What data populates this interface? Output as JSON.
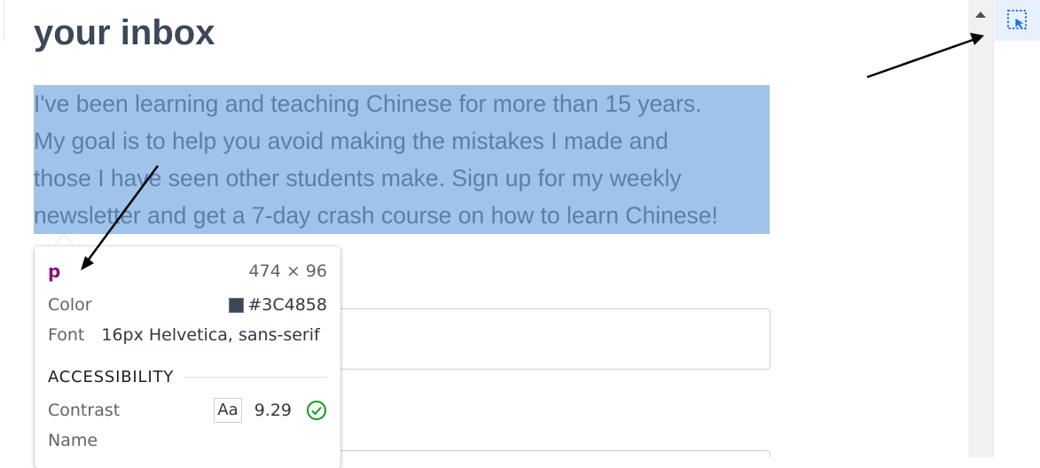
{
  "page": {
    "heading": "your inbox",
    "paragraph_lines": [
      "I've been learning and teaching Chinese for more than 15 years.",
      "My goal is to help you avoid making the mistakes I made and",
      "those I have seen other students make. Sign up for my weekly",
      "newsletter and get a 7-day crash course on how to learn Chinese!"
    ],
    "colors": {
      "text": "#3C4858",
      "selection_highlight": "#9fc3e9",
      "tag_name": "#881280",
      "contrast_pass": "#0f9d1f"
    }
  },
  "inspector_tooltip": {
    "tag": "p",
    "dimensions": "474 × 96",
    "color_label": "Color",
    "color_value": "#3C4858",
    "font_label": "Font",
    "font_value": "16px Helvetica, sans-serif",
    "accessibility_title": "ACCESSIBILITY",
    "contrast_label": "Contrast",
    "contrast_aa": "Aa",
    "contrast_value": "9.29",
    "name_label": "Name"
  },
  "icons": {
    "scroll_up": "triangle-up-icon",
    "inspect": "inspect-element-icon",
    "contrast_check": "check-circle-icon"
  }
}
